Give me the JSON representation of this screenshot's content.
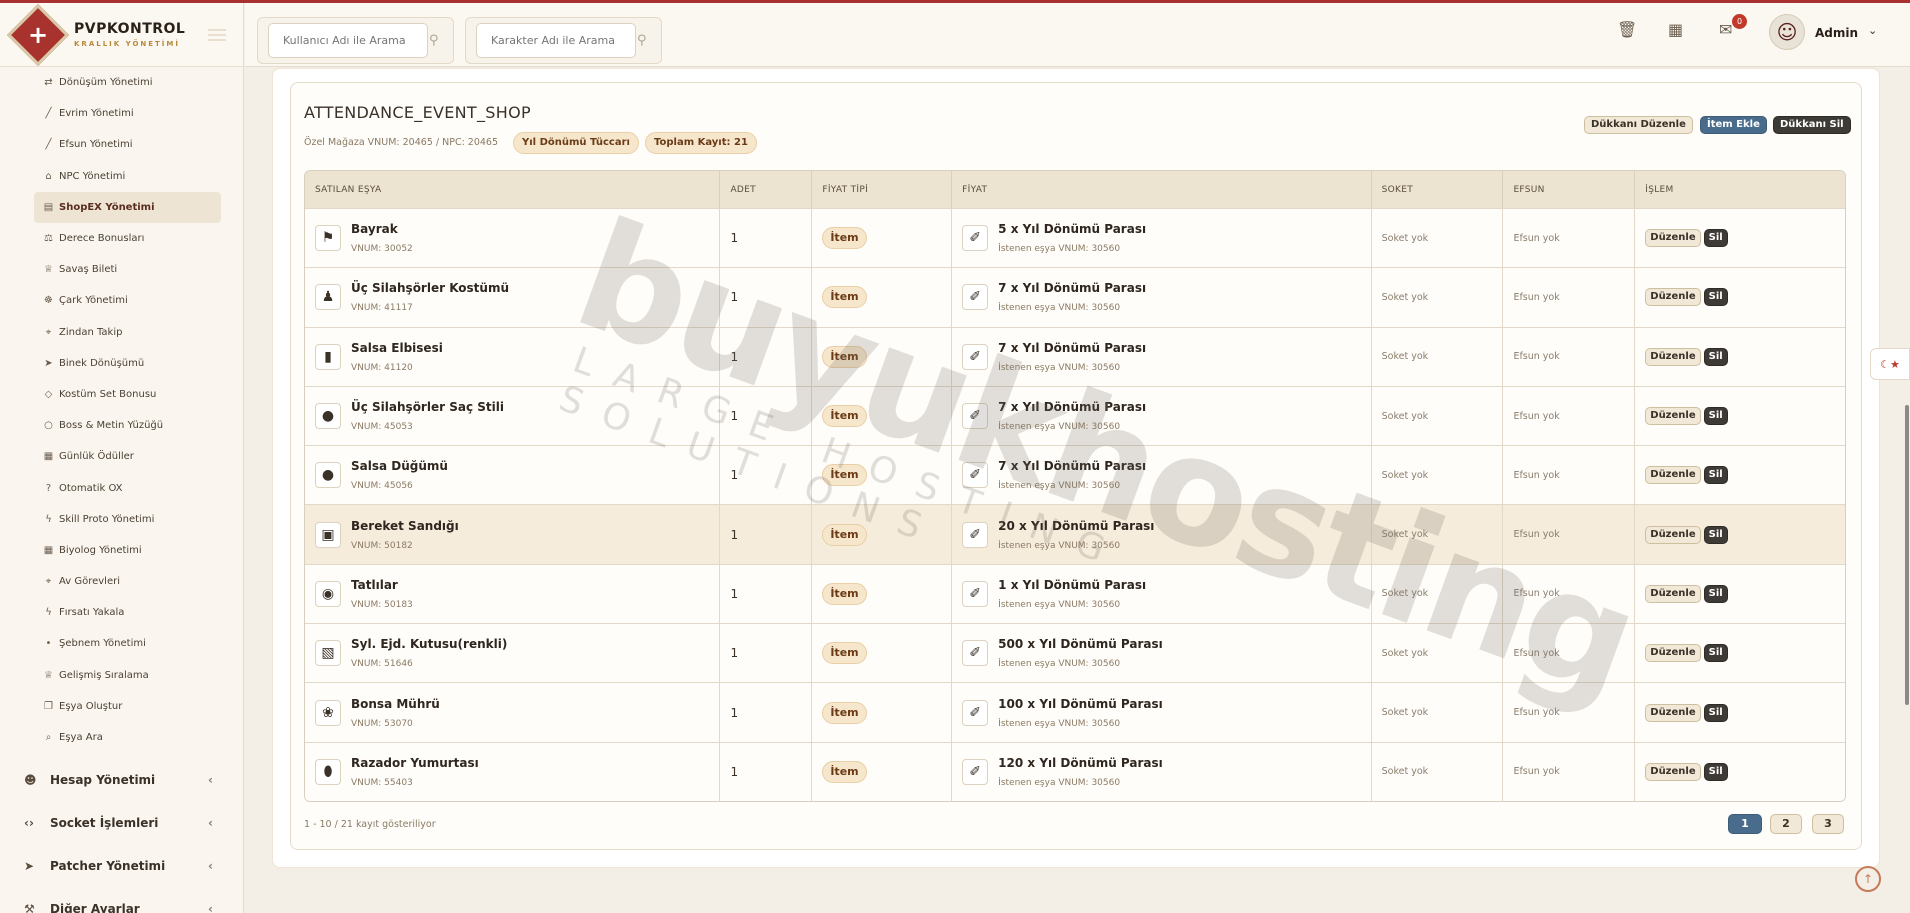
{
  "brand": {
    "title": "PVPKONTROL",
    "subtitle": "KRALLIK YÖNETİMİ"
  },
  "header": {
    "search_user_placeholder": "Kullanıcı Adı ile Arama",
    "search_char_placeholder": "Karakter Adı ile Arama",
    "notification_count": "0",
    "user_name": "Admin"
  },
  "sidebar": {
    "items": [
      {
        "label": "Dönüşüm Yönetimi",
        "icon": "shuffle-icon"
      },
      {
        "label": "Evrim Yönetimi",
        "icon": "wand-icon"
      },
      {
        "label": "Efsun Yönetimi",
        "icon": "wand-icon"
      },
      {
        "label": "NPC Yönetimi",
        "icon": "bank-icon"
      },
      {
        "label": "ShopEX Yönetimi",
        "icon": "shop-icon",
        "active": true
      },
      {
        "label": "Derece Bonusları",
        "icon": "scale-icon"
      },
      {
        "label": "Savaş Bileti",
        "icon": "trophy-icon"
      },
      {
        "label": "Çark Yönetimi",
        "icon": "wheel-icon"
      },
      {
        "label": "Zindan Takip",
        "icon": "pin-icon"
      },
      {
        "label": "Binek Dönüşümü",
        "icon": "rocket-icon"
      },
      {
        "label": "Kostüm Set Bonusu",
        "icon": "gem-icon"
      },
      {
        "label": "Boss & Metin Yüzüğü",
        "icon": "ring-icon"
      },
      {
        "label": "Günlük Ödüller",
        "icon": "calendar-icon"
      },
      {
        "label": "Otomatik OX",
        "icon": "question-icon"
      },
      {
        "label": "Skill Proto Yönetimi",
        "icon": "bolt-icon"
      },
      {
        "label": "Biyolog Yönetimi",
        "icon": "calendar-icon"
      },
      {
        "label": "Av Görevleri",
        "icon": "crosshair-icon"
      },
      {
        "label": "Fırsatı Yakala",
        "icon": "bolt-icon"
      },
      {
        "label": "Şebnem Yönetimi",
        "icon": "drop-icon"
      },
      {
        "label": "Gelişmiş Sıralama",
        "icon": "trophy-icon"
      },
      {
        "label": "Eşya Oluştur",
        "icon": "gift-icon"
      },
      {
        "label": "Eşya Ara",
        "icon": "search-icon"
      }
    ],
    "groups": [
      {
        "label": "Hesap Yönetimi",
        "icon": "users-icon"
      },
      {
        "label": "Socket İşlemleri",
        "icon": "code-icon"
      },
      {
        "label": "Patcher Yönetimi",
        "icon": "rocket-icon"
      },
      {
        "label": "Diğer Ayarlar",
        "icon": "wrench-icon"
      }
    ]
  },
  "shop": {
    "title": "ATTENDANCE_EVENT_SHOP",
    "subtitle": "Özel Mağaza VNUM: 20465 / NPC: 20465",
    "merchant_pill": "Yıl Dönümü Tüccarı",
    "total_pill": "Toplam Kayıt: 21",
    "edit_shop": "Dükkanı Düzenle",
    "add_item": "İtem Ekle",
    "delete_shop": "Dükkanı Sil"
  },
  "table": {
    "columns": [
      "SATILAN EŞYA",
      "ADET",
      "FİYAT TİPİ",
      "FİYAT",
      "SOKET",
      "EFSUN",
      "İŞLEM"
    ],
    "rows": [
      {
        "name": "Bayrak",
        "vnum": "VNUM: 30052",
        "qty": "1",
        "type": "İtem",
        "price": "5 x Yıl Dönümü Parası",
        "price_vnum": "İstenen eşya VNUM: 30560",
        "socket": "Soket yok",
        "bonus": "Efsun yok",
        "icon": "flag-icon"
      },
      {
        "name": "Üç Silahşörler Kostümü",
        "vnum": "VNUM: 41117",
        "qty": "1",
        "type": "İtem",
        "price": "7 x Yıl Dönümü Parası",
        "price_vnum": "İstenen eşya VNUM: 30560",
        "socket": "Soket yok",
        "bonus": "Efsun yok",
        "icon": "costume-icon"
      },
      {
        "name": "Salsa Elbisesi",
        "vnum": "VNUM: 41120",
        "qty": "1",
        "type": "İtem",
        "price": "7 x Yıl Dönümü Parası",
        "price_vnum": "İstenen eşya VNUM: 30560",
        "socket": "Soket yok",
        "bonus": "Efsun yok",
        "icon": "dress-icon"
      },
      {
        "name": "Üç Silahşörler Saç Stili",
        "vnum": "VNUM: 45053",
        "qty": "1",
        "type": "İtem",
        "price": "7 x Yıl Dönümü Parası",
        "price_vnum": "İstenen eşya VNUM: 30560",
        "socket": "Soket yok",
        "bonus": "Efsun yok",
        "icon": "hair-icon"
      },
      {
        "name": "Salsa Düğümü",
        "vnum": "VNUM: 45056",
        "qty": "1",
        "type": "İtem",
        "price": "7 x Yıl Dönümü Parası",
        "price_vnum": "İstenen eşya VNUM: 30560",
        "socket": "Soket yok",
        "bonus": "Efsun yok",
        "icon": "hair-icon"
      },
      {
        "name": "Bereket Sandığı",
        "vnum": "VNUM: 50182",
        "qty": "1",
        "type": "İtem",
        "price": "20 x Yıl Dönümü Parası",
        "price_vnum": "İstenen eşya VNUM: 30560",
        "socket": "Soket yok",
        "bonus": "Efsun yok",
        "icon": "chest-icon",
        "highlight": true
      },
      {
        "name": "Tatlılar",
        "vnum": "VNUM: 50183",
        "qty": "1",
        "type": "İtem",
        "price": "1 x Yıl Dönümü Parası",
        "price_vnum": "İstenen eşya VNUM: 30560",
        "socket": "Soket yok",
        "bonus": "Efsun yok",
        "icon": "candy-icon"
      },
      {
        "name": "Syl. Ejd. Kutusu(renkli)",
        "vnum": "VNUM: 51646",
        "qty": "1",
        "type": "İtem",
        "price": "500 x Yıl Dönümü Parası",
        "price_vnum": "İstenen eşya VNUM: 30560",
        "socket": "Soket yok",
        "bonus": "Efsun yok",
        "icon": "box-icon"
      },
      {
        "name": "Bonsa Mührü",
        "vnum": "VNUM: 53070",
        "qty": "1",
        "type": "İtem",
        "price": "100 x Yıl Dönümü Parası",
        "price_vnum": "İstenen eşya VNUM: 30560",
        "socket": "Soket yok",
        "bonus": "Efsun yok",
        "icon": "seal-icon"
      },
      {
        "name": "Razador Yumurtası",
        "vnum": "VNUM: 55403",
        "qty": "1",
        "type": "İtem",
        "price": "120 x Yıl Dönümü Parası",
        "price_vnum": "İstenen eşya VNUM: 30560",
        "socket": "Soket yok",
        "bonus": "Efsun yok",
        "icon": "egg-icon"
      }
    ],
    "edit_label": "Düzenle",
    "delete_label": "Sil"
  },
  "footer": {
    "info": "1 - 10 / 21 kayıt gösteriliyor",
    "pages": [
      "1",
      "2",
      "3"
    ]
  },
  "watermark": {
    "main": "buyukhosting",
    "sub": "LARGE HOSTING SOLUTIONS"
  },
  "colors": {
    "accent": "#a8322e",
    "primary_button": "#4a6c8c",
    "dark_button": "#3e3a35",
    "pill_bg": "#f6e6cc"
  }
}
